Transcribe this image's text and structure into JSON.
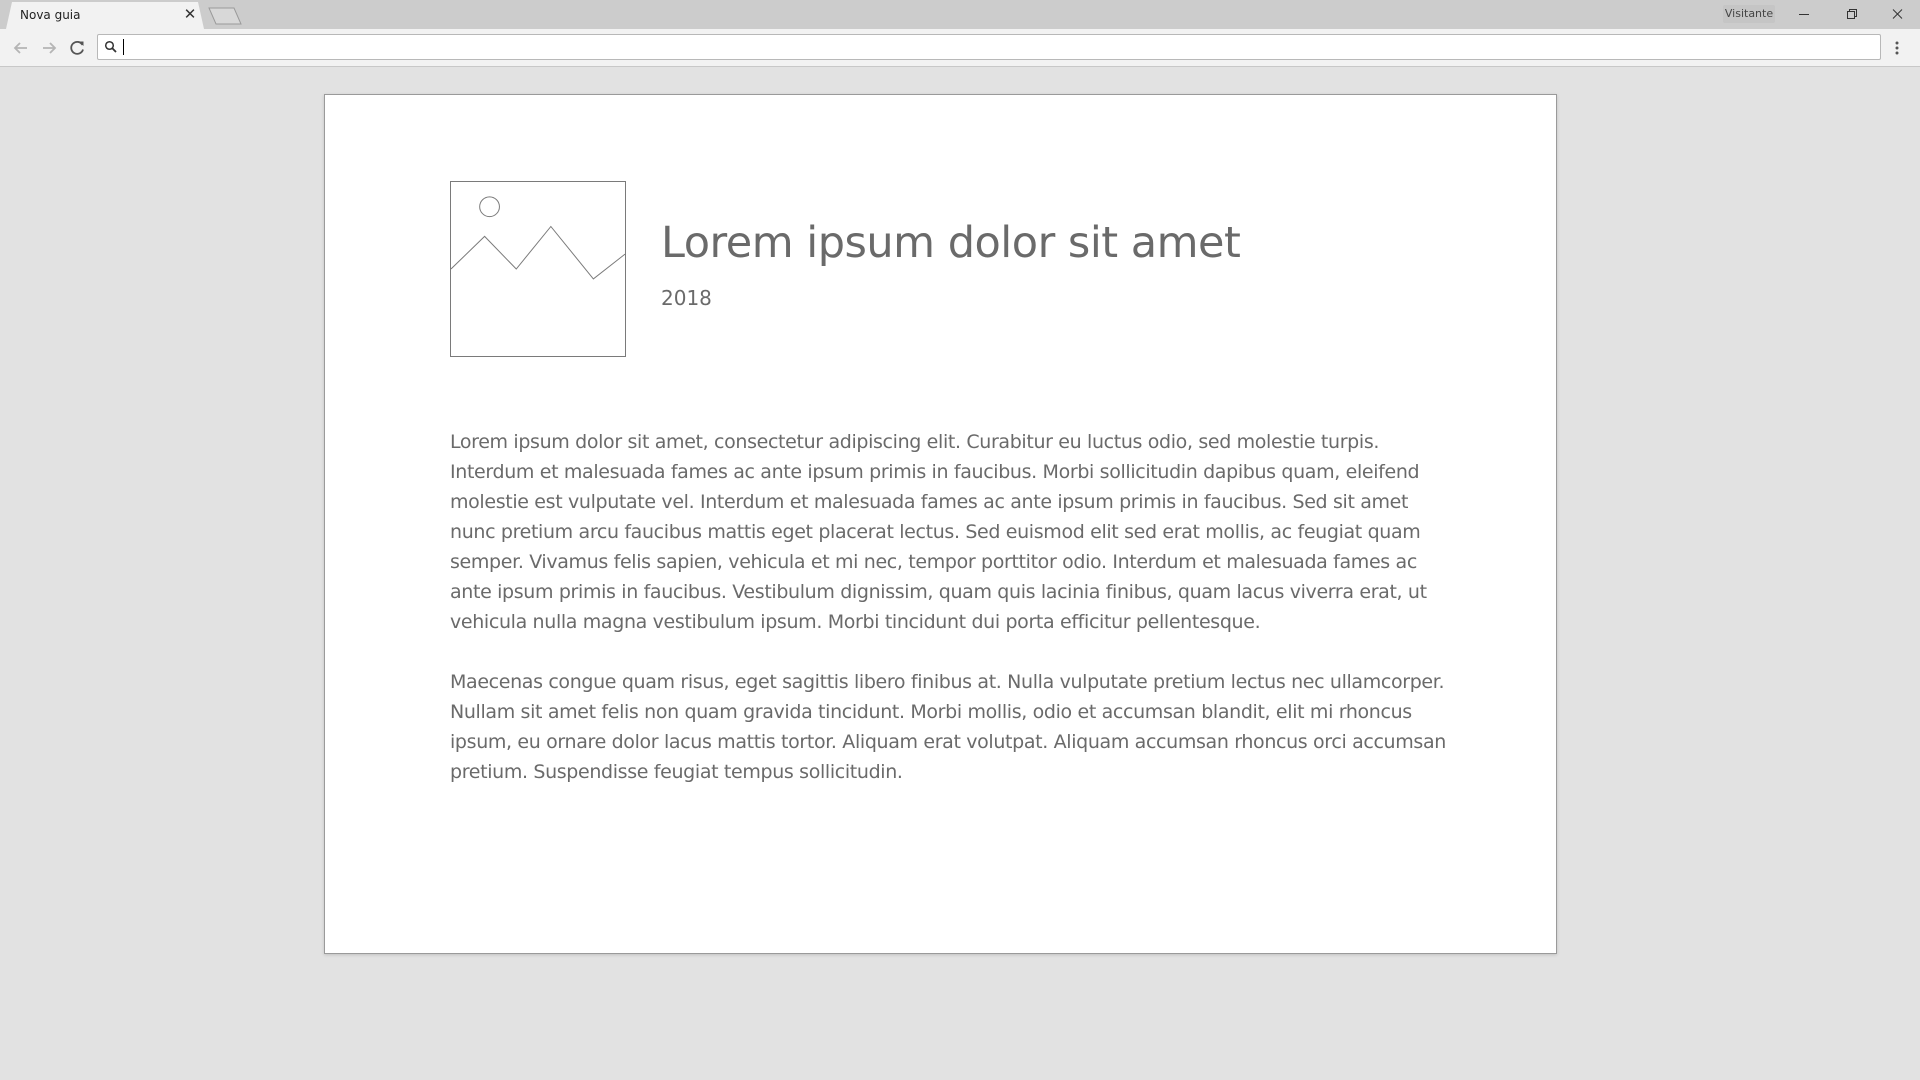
{
  "browser": {
    "tab_title": "Nova guia",
    "tab_close": "✕",
    "profile_label": "Visitante",
    "omnibox_value": ""
  },
  "page": {
    "title": "Lorem ipsum dolor sit amet",
    "year": "2018",
    "paragraphs": [
      "Lorem ipsum dolor sit amet, consectetur adipiscing elit. Curabitur eu luctus odio, sed molestie turpis. Interdum et malesuada fames ac ante ipsum primis in faucibus. Morbi sollicitudin dapibus quam, eleifend molestie est vulputate vel. Interdum et malesuada fames ac ante ipsum primis in faucibus. Sed sit amet nunc pretium arcu faucibus mattis eget placerat lectus. Sed euismod elit sed erat mollis, ac feugiat quam semper. Vivamus felis sapien, vehicula et mi nec, tempor porttitor odio. Interdum et malesuada fames ac ante ipsum primis in faucibus. Vestibulum dignissim, quam quis lacinia finibus, quam lacus viverra erat, ut vehicula nulla magna vestibulum ipsum. Morbi tincidunt dui porta efficitur pellentesque.",
      "Maecenas congue quam risus, eget sagittis libero finibus at. Nulla vulputate pretium lectus nec ullamcorper. Nullam sit amet felis non quam gravida tincidunt. Morbi mollis, odio et accumsan blandit, elit mi rhoncus ipsum, eu ornare dolor lacus mattis tortor. Aliquam erat volutpat. Aliquam accumsan rhoncus orci accumsan pretium. Suspendisse feugiat tempus sollicitudin."
    ]
  },
  "icons": {
    "back": "arrow-left-icon",
    "forward": "arrow-right-icon",
    "reload": "reload-icon",
    "search": "search-icon",
    "menu": "kebab-menu-icon",
    "minimize": "minimize-icon",
    "restore": "restore-icon",
    "close": "close-icon",
    "image_placeholder": "image-placeholder-icon"
  },
  "colors": {
    "chrome_frame": "#cccccc",
    "toolbar": "#f2f2f2",
    "page_bg": "#e2e2e2",
    "card_bg": "#ffffff",
    "text": "#6a6a6a"
  }
}
